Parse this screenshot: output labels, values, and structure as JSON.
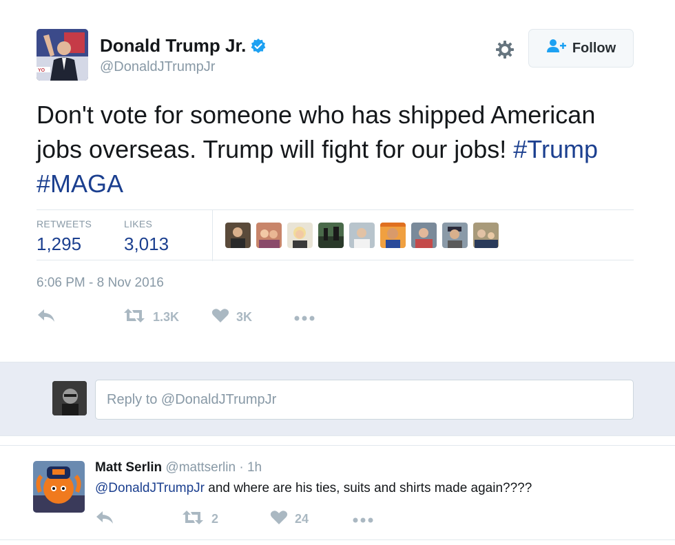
{
  "tweet": {
    "author_name": "Donald Trump Jr.",
    "author_handle": "@DonaldJTrumpJr",
    "follow_label": "Follow",
    "text_plain": "Don't vote for someone who has shipped American jobs overseas. Trump will fight for our jobs! ",
    "hashtags": [
      "#Trump",
      "#MAGA"
    ],
    "retweets_label": "RETWEETS",
    "retweets_count": "1,295",
    "likes_label": "LIKES",
    "likes_count": "3,013",
    "timestamp": "6:06 PM - 8 Nov 2016",
    "action_retweet_count": "1.3K",
    "action_like_count": "3K"
  },
  "reply_box": {
    "placeholder": "Reply to @DonaldJTrumpJr"
  },
  "reply_tweet": {
    "author_name": "Matt Serlin",
    "author_handle": "@mattserlin",
    "time": "· 1h",
    "mention": "@DonaldJTrumpJr",
    "text": " and where are his ties, suits and shirts made again????",
    "retweet_count": "2",
    "like_count": "24"
  },
  "icons": {
    "verified": "verified-badge-icon",
    "gear": "gear-icon",
    "follow": "follow-person-icon",
    "reply": "reply-icon",
    "retweet": "retweet-icon",
    "like": "heart-icon",
    "more": "more-dots-icon"
  },
  "colors": {
    "link": "#1b3f8f",
    "muted": "#8899a6",
    "icon": "#aab8c2",
    "verified": "#1da1f2",
    "reply_box_bg": "#e8ecf4"
  }
}
